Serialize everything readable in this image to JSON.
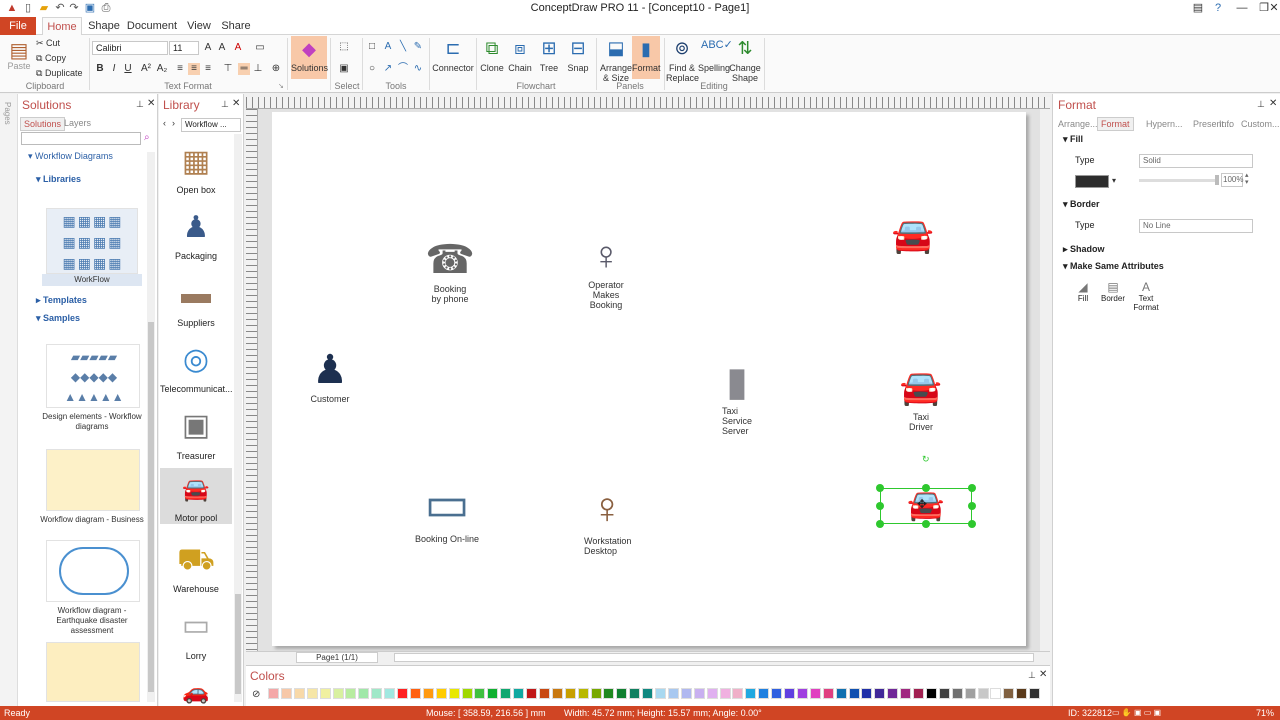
{
  "window": {
    "title": "ConceptDraw PRO 11 - [Concept10 - Page1]"
  },
  "menu_tabs": [
    "File",
    "Home",
    "Shape",
    "Document",
    "View",
    "Share"
  ],
  "ribbon": {
    "clipboard": {
      "paste": "Paste",
      "cut": "Cut",
      "copy": "Copy",
      "duplicate": "Duplicate",
      "label": "Clipboard"
    },
    "text_format": {
      "font": "Calibri",
      "size": "11",
      "label": "Text Format"
    },
    "panels_solutions": "Solutions",
    "select_label": "Select",
    "tools_label": "Tools",
    "connector": "Connector",
    "flowchart": {
      "clone": "Clone",
      "chain": "Chain",
      "tree": "Tree",
      "snap": "Snap",
      "label": "Flowchart"
    },
    "panels": {
      "arrange": "Arrange\n& Size",
      "format": "Format",
      "label": "Panels"
    },
    "editing": {
      "find": "Find &\nReplace",
      "spelling": "Spelling",
      "change": "Change\nShape",
      "label": "Editing"
    }
  },
  "solutions_panel": {
    "title": "Solutions",
    "tabs": [
      "Solutions",
      "Layers"
    ],
    "tree": {
      "workflow": "Workflow Diagrams",
      "libraries": "Libraries",
      "library_thumb": "WorkFlow",
      "templates": "Templates",
      "samples": "Samples"
    },
    "samples": [
      "Design elements - Workflow diagrams",
      "Workflow diagram - Business",
      "Workflow diagram - Earthquake disaster assessment"
    ]
  },
  "library_panel": {
    "title": "Library",
    "combo": "Workflow ...",
    "items": [
      "Open box",
      "Packaging",
      "Suppliers",
      "Telecommunicat...",
      "Treasurer",
      "Motor pool",
      "Warehouse",
      "Lorry"
    ]
  },
  "canvas": {
    "shapes": [
      {
        "label": "Booking\nby phone"
      },
      {
        "label": "Operator\nMakes\nBooking"
      },
      {
        "label": "Customer"
      },
      {
        "label": "Taxi\nService\nServer"
      },
      {
        "label": "Taxi\nDriver"
      },
      {
        "label": "Booking On-line"
      },
      {
        "label": "Workstation\nDesktop"
      }
    ],
    "page_tab": "Page1 (1/1)"
  },
  "colors_panel": {
    "title": "Colors",
    "swatches": [
      "#f4a7a7",
      "#f7c8a8",
      "#f8d9a8",
      "#f6e6a6",
      "#f0f0a0",
      "#d8f0a0",
      "#b8eca0",
      "#a0e8a8",
      "#a0e8c8",
      "#a0e8e0",
      "#ff2020",
      "#ff6010",
      "#ff9a10",
      "#ffcc00",
      "#e8e800",
      "#a0d800",
      "#40c040",
      "#10b030",
      "#10a870",
      "#10a8a0",
      "#c01818",
      "#c84810",
      "#c87810",
      "#c8a000",
      "#b8b800",
      "#78a800",
      "#208820",
      "#108030",
      "#108060",
      "#108880",
      "#a8d8f0",
      "#a8c8f0",
      "#b0b8f0",
      "#c8b0f0",
      "#e0b0f0",
      "#f0b0e0",
      "#f0b0c8",
      "#20a8e0",
      "#2080e0",
      "#3060e0",
      "#6040e0",
      "#a040e0",
      "#e040c0",
      "#e04080",
      "#1070b0",
      "#1050b0",
      "#2030a8",
      "#402898",
      "#702898",
      "#a02880",
      "#a02050",
      "#000000",
      "#404040",
      "#707070",
      "#a0a0a0",
      "#c8c8c8",
      "#ffffff",
      "#806040",
      "#5a3a1a",
      "#303030"
    ]
  },
  "format_panel": {
    "title": "Format",
    "tabs": [
      "Arrange...",
      "Format",
      "Hypern...",
      "Present...",
      "Info",
      "Custom..."
    ],
    "fill": {
      "section": "Fill",
      "type_label": "Type",
      "type_value": "Solid",
      "opacity": "100%",
      "color": "#2d2d2d"
    },
    "border": {
      "section": "Border",
      "type_label": "Type",
      "type_value": "No Line"
    },
    "shadow": {
      "section": "Shadow"
    },
    "same": {
      "section": "Make Same Attributes",
      "fill": "Fill",
      "border": "Border",
      "text": "Text\nFormat"
    }
  },
  "status": {
    "ready": "Ready",
    "mouse": "Mouse: [ 358.59, 216.56 ] mm",
    "size": "Width: 45.72 mm;  Height: 15.57 mm;  Angle: 0.00°",
    "id": "ID: 322812",
    "zoom": "71%"
  }
}
